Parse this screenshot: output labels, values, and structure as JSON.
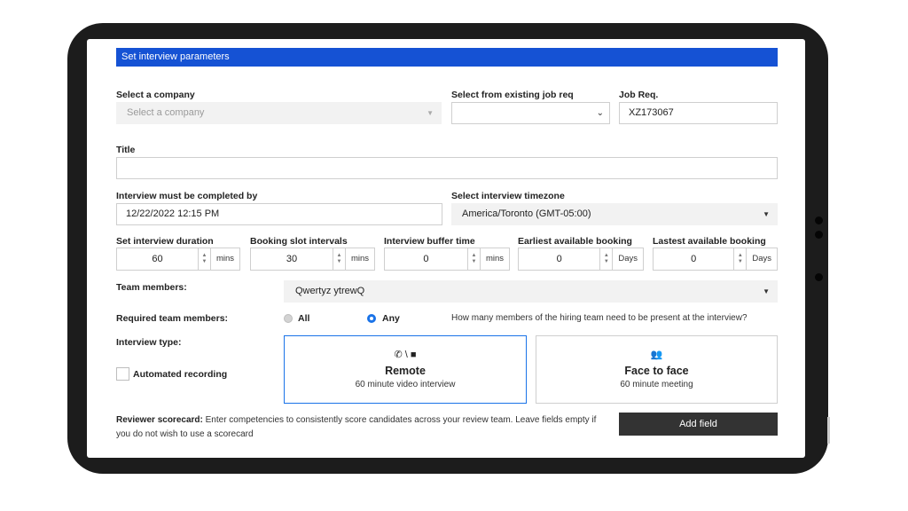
{
  "header": {
    "title": "Set interview parameters"
  },
  "company": {
    "label": "Select a company",
    "placeholder": "Select a company"
  },
  "job_req_select": {
    "label": "Select from existing job req",
    "value": ""
  },
  "job_req": {
    "label": "Job Req.",
    "value": "XZ173067"
  },
  "title_field": {
    "label": "Title",
    "value": ""
  },
  "deadline": {
    "label": "Interview must be completed by",
    "value": "12/22/2022 12:15 PM"
  },
  "timezone": {
    "label": "Select interview timezone",
    "value": "America/Toronto (GMT-05:00)"
  },
  "numbers": [
    {
      "label": "Set interview duration",
      "value": "60",
      "unit": "mins"
    },
    {
      "label": "Booking slot intervals",
      "value": "30",
      "unit": "mins"
    },
    {
      "label": "Interview buffer time",
      "value": "0",
      "unit": "mins"
    },
    {
      "label": "Earliest available booking",
      "value": "0",
      "unit": "Days"
    },
    {
      "label": "Lastest available booking",
      "value": "0",
      "unit": "Days"
    }
  ],
  "team": {
    "label": "Team members:",
    "value": "Qwertyz ytrewQ"
  },
  "required": {
    "label": "Required team members:",
    "opt_all": "All",
    "opt_any": "Any",
    "selected": "Any",
    "help": "How many members of the hiring team need to be present at the interview?"
  },
  "interview_type": {
    "label": "Interview type:",
    "automated_recording": "Automated recording",
    "selected": "Remote",
    "remote": {
      "icon": "phone-video-icon",
      "icon_glyph": "✆ \\ ■",
      "title": "Remote",
      "sub": "60 minute video interview"
    },
    "face": {
      "icon": "group-icon",
      "icon_glyph": "👥",
      "title": "Face to face",
      "sub": "60 minute meeting"
    }
  },
  "scorecard": {
    "label": "Reviewer scorecard:",
    "text": "Enter competencies to consistently score candidates across your review team. Leave fields empty if you do not wish to use a scorecard",
    "button": "Add field"
  },
  "colors": {
    "accent": "#1552d4",
    "selected_border": "#1a73e8",
    "dark_button": "#333333"
  }
}
